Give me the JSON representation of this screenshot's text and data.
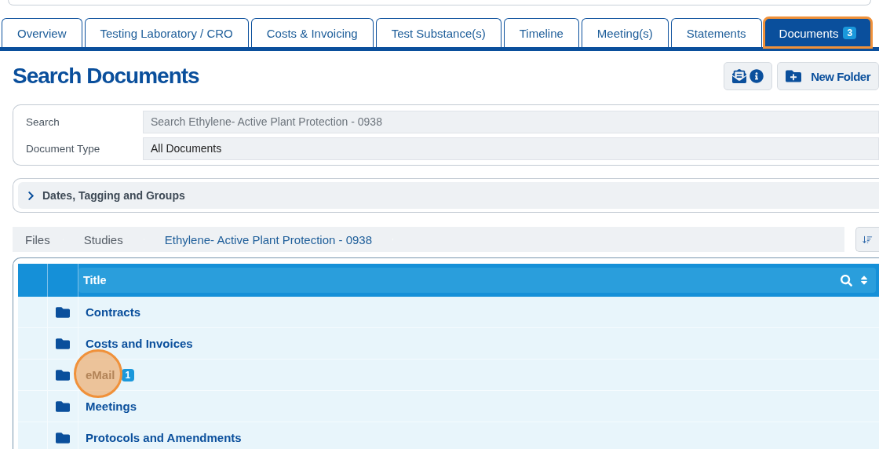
{
  "tabs": [
    {
      "label": "Overview",
      "selected": false,
      "highlighted": false
    },
    {
      "label": "Testing Laboratory / CRO",
      "selected": false,
      "highlighted": false
    },
    {
      "label": "Costs & Invoicing",
      "selected": false,
      "highlighted": false
    },
    {
      "label": "Test Substance(s)",
      "selected": false,
      "highlighted": false
    },
    {
      "label": "Timeline",
      "selected": false,
      "highlighted": false
    },
    {
      "label": "Meeting(s)",
      "selected": false,
      "highlighted": false
    },
    {
      "label": "Statements",
      "selected": false,
      "highlighted": false
    },
    {
      "label": "Documents",
      "selected": true,
      "highlighted": true,
      "badge": "3"
    }
  ],
  "page_title": "Search Documents",
  "new_folder_button": "New Folder",
  "filters": [
    {
      "label": "Search",
      "placeholder": "Search Ethylene- Active Plant Protection - 0938"
    },
    {
      "label": "Document Type",
      "value": "All Documents"
    }
  ],
  "collapsible": {
    "label": "Dates, Tagging and Groups",
    "expanded": false
  },
  "breadcrumb": [
    "Files",
    "Studies",
    "Ethylene- Active Plant Protection - 0938"
  ],
  "table": {
    "columns": [
      "Title"
    ],
    "rows": [
      {
        "kind": "folder",
        "title": "Contracts",
        "highlighted": false
      },
      {
        "kind": "folder",
        "title": "Costs and Invoices",
        "highlighted": false
      },
      {
        "kind": "folder",
        "title": "eMail",
        "badge": "1",
        "highlighted": true
      },
      {
        "kind": "folder",
        "title": "Meetings",
        "highlighted": false
      },
      {
        "kind": "folder",
        "title": "Protocols and Amendments",
        "highlighted": false
      }
    ]
  }
}
